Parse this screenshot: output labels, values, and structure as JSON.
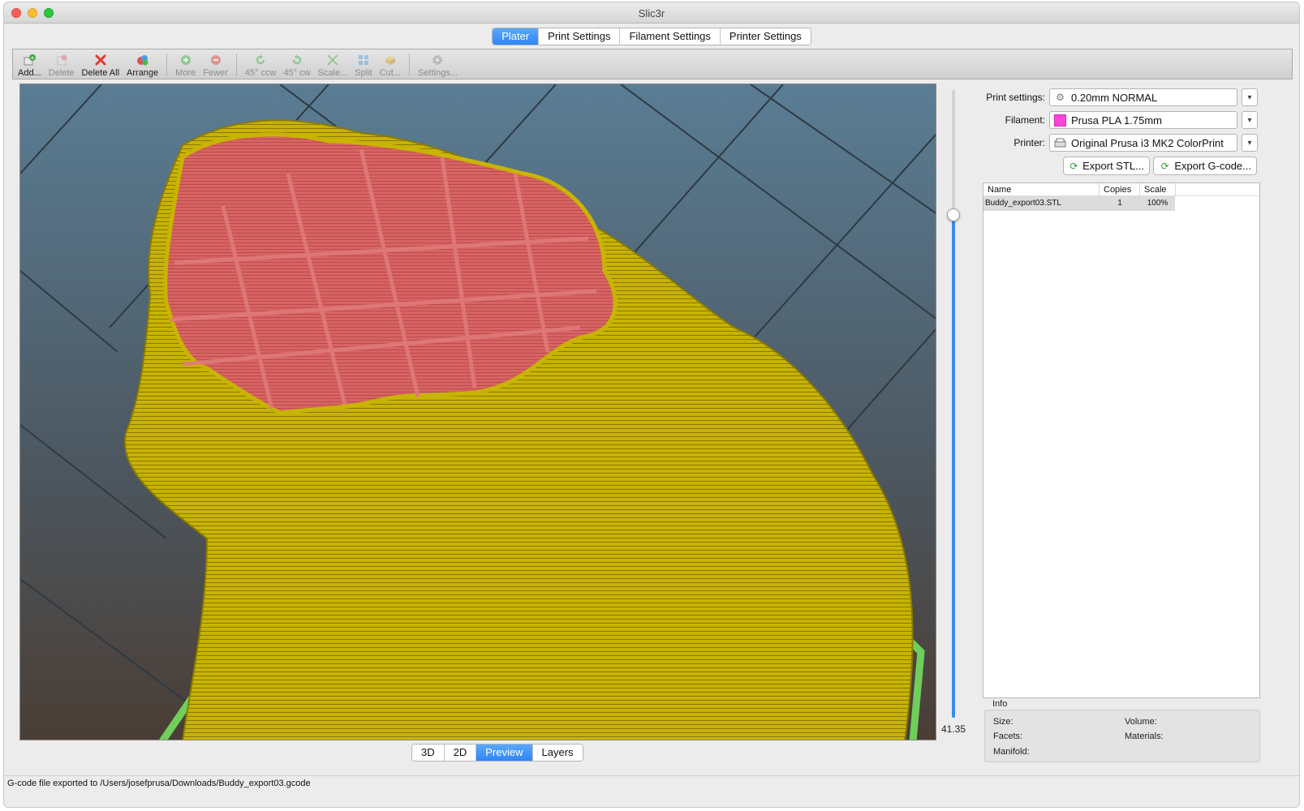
{
  "window": {
    "title": "Slic3r"
  },
  "tabs": [
    "Plater",
    "Print Settings",
    "Filament Settings",
    "Printer Settings"
  ],
  "active_tab": "Plater",
  "toolbar": {
    "add": "Add...",
    "delete": "Delete",
    "delete_all": "Delete All",
    "arrange": "Arrange",
    "more": "More",
    "fewer": "Fewer",
    "rotate_ccw": "45° ccw",
    "rotate_cw": "45° cw",
    "scale": "Scale...",
    "split": "Split",
    "cut": "Cut...",
    "settings": "Settings..."
  },
  "viewport": {
    "layer_value": "41.35",
    "slider_level": 0.8
  },
  "view_tabs": [
    "3D",
    "2D",
    "Preview",
    "Layers"
  ],
  "active_view": "Preview",
  "panel": {
    "print_settings_label": "Print settings:",
    "print_settings_value": "0.20mm NORMAL",
    "filament_label": "Filament:",
    "filament_value": "Prusa PLA 1.75mm",
    "filament_color": "#ff44d8",
    "printer_label": "Printer:",
    "printer_value": "Original Prusa i3 MK2 ColorPrint",
    "export_stl": "Export STL...",
    "export_gcode": "Export G-code..."
  },
  "object_list": {
    "columns": [
      "Name",
      "Copies",
      "Scale"
    ],
    "rows": [
      {
        "name": "Buddy_export03.STL",
        "copies": "1",
        "scale": "100%"
      }
    ]
  },
  "info": {
    "title": "Info",
    "size": "Size:",
    "volume": "Volume:",
    "facets": "Facets:",
    "materials": "Materials:",
    "manifold": "Manifold:"
  },
  "status_bar": "G-code file exported to /Users/josefprusa/Downloads/Buddy_export03.gcode",
  "colors": {
    "accent": "#2e86f8",
    "perimeter": "#c8b400",
    "infill": "#d96363",
    "skirt": "#6fcf5a",
    "bed_grid": "#2e3a44"
  }
}
